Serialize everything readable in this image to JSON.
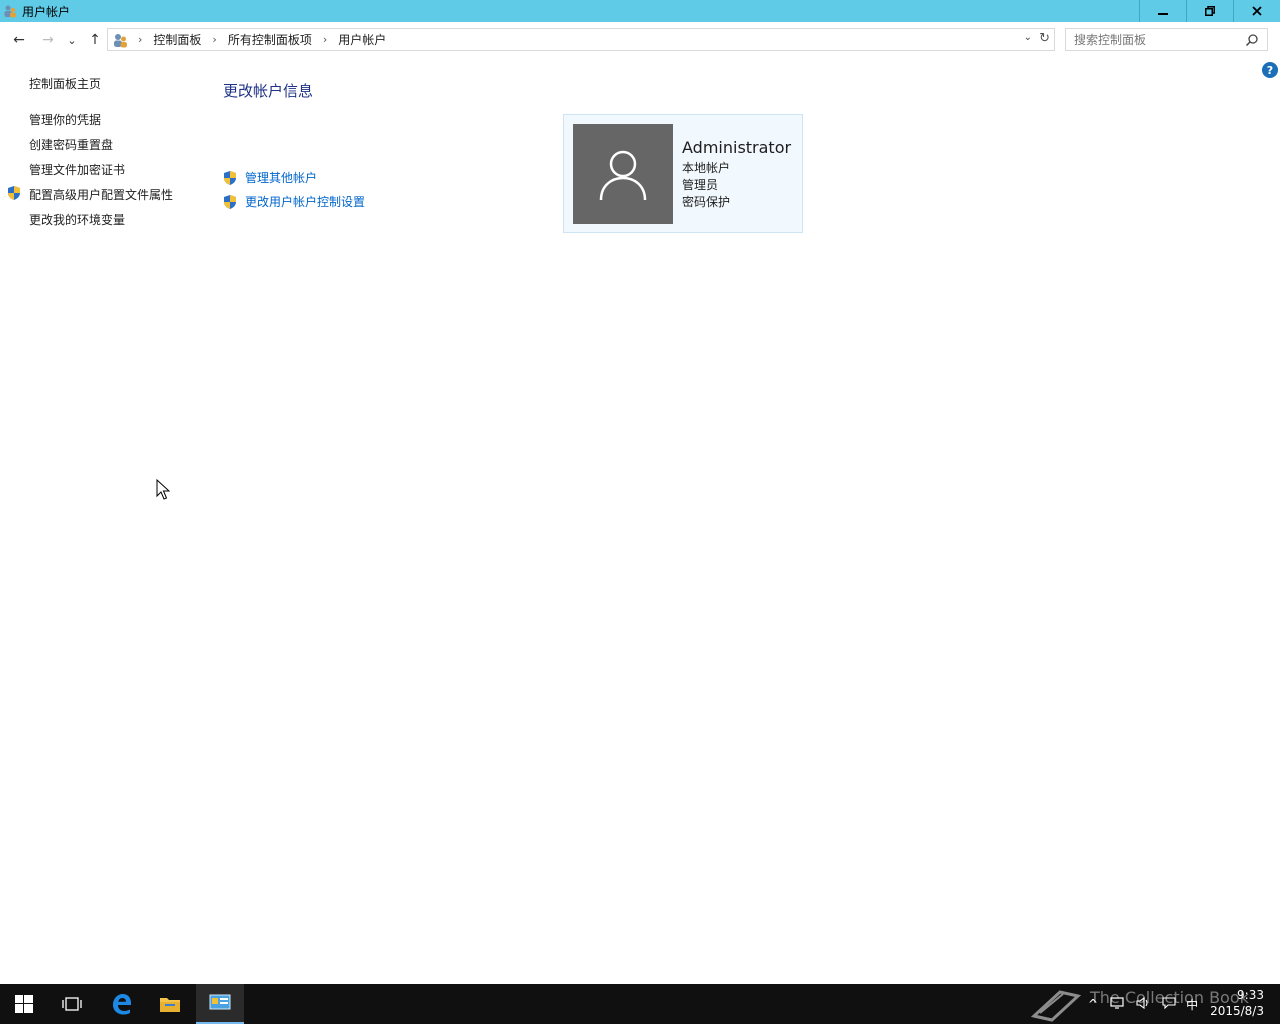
{
  "window": {
    "title": "用户帐户",
    "controls": {
      "minimize": "−",
      "restore": "❐",
      "close": "✕"
    }
  },
  "navigation": {
    "back_icon": "←",
    "forward_icon": "→",
    "recent_icon": "⌄",
    "up_icon": "↑",
    "breadcrumbs": [
      "控制面板",
      "所有控制面板项",
      "用户帐户"
    ],
    "search_placeholder": "搜索控制面板"
  },
  "left_nav": {
    "home": "控制面板主页",
    "items": [
      "管理你的凭据",
      "创建密码重置盘",
      "管理文件加密证书",
      "配置高级用户配置文件属性",
      "更改我的环境变量"
    ]
  },
  "main": {
    "title": "更改帐户信息",
    "tasks": [
      "管理其他帐户",
      "更改用户帐户控制设置"
    ]
  },
  "account": {
    "name": "Administrator",
    "type": "本地帐户",
    "role": "管理员",
    "protection": "密码保护"
  },
  "taskbar": {
    "time": "9:33",
    "date": "2015/8/3",
    "ime": "中",
    "watermark": "The Collection Book"
  },
  "colors": {
    "titlebar": "#5fcbe7",
    "link": "#0066cc",
    "heading": "#1e3287",
    "avatar_bg": "#666666",
    "card_bg": "#f2f9fe"
  }
}
